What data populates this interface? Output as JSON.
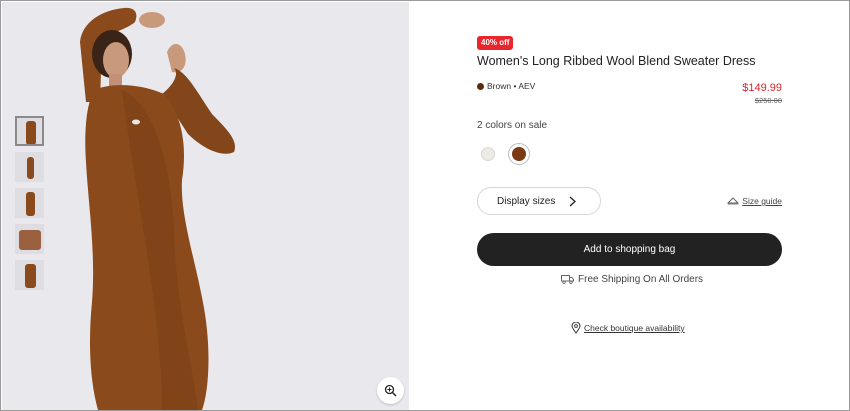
{
  "gallery": {
    "thumbnail_count": 5,
    "active_thumbnail": 1,
    "zoom_icon": "zoom-in-icon"
  },
  "product": {
    "discount_badge": "40% off",
    "title": "Women's Long Ribbed Wool Blend Sweater Dress",
    "color_label": "Brown • AEV",
    "price": "$149.99",
    "original_price": "$250.00",
    "colors_on_sale": "2 colors on sale",
    "swatches": [
      {
        "name": "cream",
        "color": "#ecebe6",
        "selected": false
      },
      {
        "name": "brown",
        "color": "#7b3a12",
        "selected": true
      }
    ]
  },
  "actions": {
    "display_sizes_label": "Display sizes",
    "size_guide_label": "Size guide",
    "add_to_bag_label": "Add to shopping bag",
    "shipping_text": "Free Shipping On All Orders",
    "boutique_label": "Check boutique availability"
  },
  "colors": {
    "accent_badge": "#e8262c",
    "price_red": "#d9262c",
    "button_dark": "#222222",
    "product_brown": "#8a4a1b"
  }
}
